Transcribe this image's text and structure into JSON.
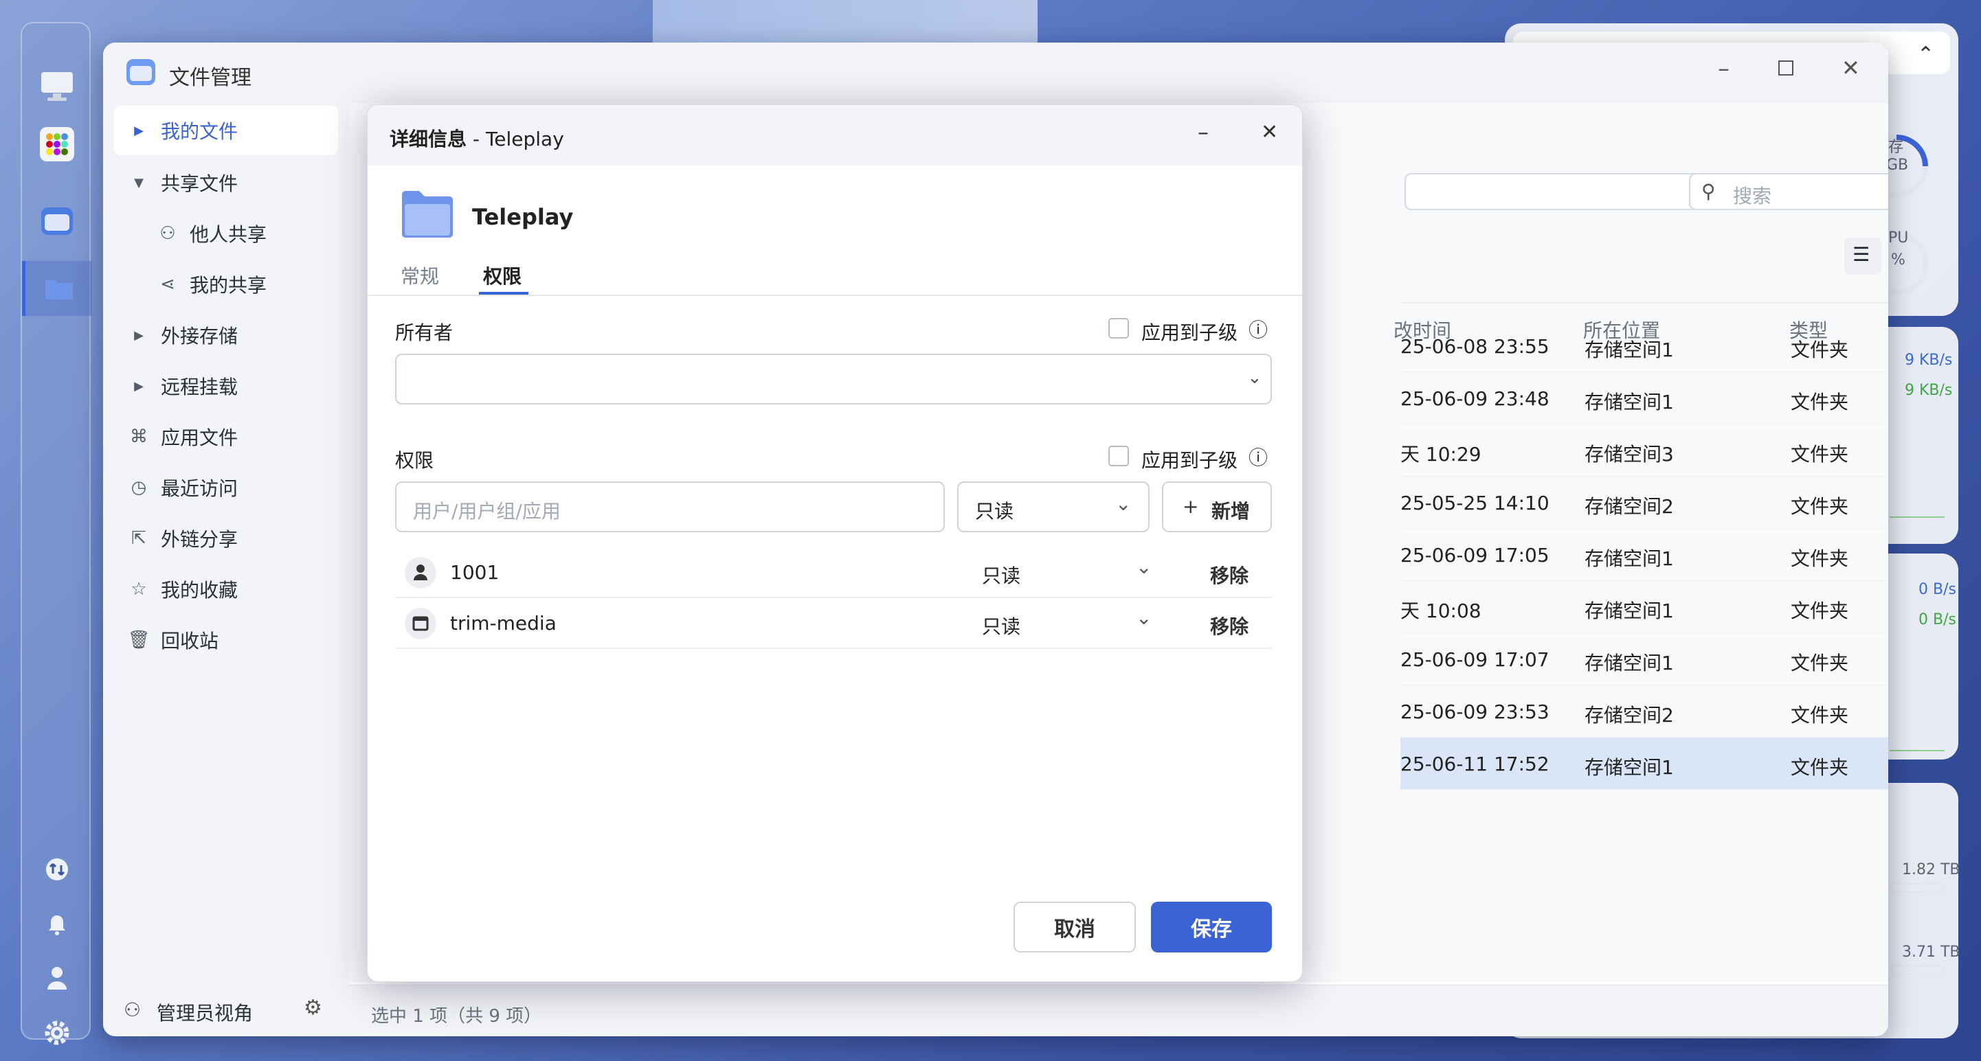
{
  "window": {
    "title": "文件管理"
  },
  "sidebar": {
    "items": [
      {
        "label": "我的文件"
      },
      {
        "label": "共享文件"
      },
      {
        "label": "他人共享"
      },
      {
        "label": "我的共享"
      },
      {
        "label": "外接存储"
      },
      {
        "label": "远程挂载"
      },
      {
        "label": "应用文件"
      },
      {
        "label": "最近访问"
      },
      {
        "label": "外链分享"
      },
      {
        "label": "我的收藏"
      },
      {
        "label": "回收站"
      }
    ],
    "footer_label": "管理员视角"
  },
  "search": {
    "placeholder": "搜索"
  },
  "table": {
    "headers": {
      "time": "改时间",
      "location": "所在位置",
      "type": "类型"
    },
    "rows": [
      {
        "time": "25-06-08 23:55",
        "location": "存储空间1",
        "type": "文件夹"
      },
      {
        "time": "25-06-09 23:48",
        "location": "存储空间1",
        "type": "文件夹"
      },
      {
        "time": "天 10:29",
        "location": "存储空间3",
        "type": "文件夹"
      },
      {
        "time": "25-05-25 14:10",
        "location": "存储空间2",
        "type": "文件夹"
      },
      {
        "time": "25-06-09 17:05",
        "location": "存储空间1",
        "type": "文件夹"
      },
      {
        "time": "天 10:08",
        "location": "存储空间1",
        "type": "文件夹"
      },
      {
        "time": "25-06-09 17:07",
        "location": "存储空间1",
        "type": "文件夹"
      },
      {
        "time": "25-06-09 23:53",
        "location": "存储空间2",
        "type": "文件夹"
      },
      {
        "time": "25-06-11 17:52",
        "location": "存储空间1",
        "type": "文件夹"
      }
    ]
  },
  "status": {
    "text": "选中 1 项（共 9 项）"
  },
  "widgets": {
    "mem_label": "存",
    "mem_value": "GB",
    "cpu_label": "PU",
    "cpu_value": "%",
    "net_up_1": "9 KB/s",
    "net_down_1": "9 KB/s",
    "net_up_2": "0 B/s",
    "net_down_2": "0 B/s",
    "disk_1": "1.82 TB",
    "disk_2": "3.71 TB"
  },
  "dialog": {
    "title": "详细信息",
    "title_sep": " - ",
    "title_name": "Teleplay",
    "folder_name": "Teleplay",
    "tabs": [
      "常规",
      "权限"
    ],
    "owner_label": "所有者",
    "apply_children": "应用到子级",
    "perm_label": "权限",
    "perm_placeholder": "用户/用户组/应用",
    "perm_select": "只读",
    "add_label": "新增",
    "entries": [
      {
        "name": "1001",
        "perm": "只读",
        "remove": "移除"
      },
      {
        "name": "trim-media",
        "perm": "只读",
        "remove": "移除"
      }
    ],
    "cancel": "取消",
    "save": "保存"
  },
  "colors": {
    "accent": "#3b63d6",
    "selected_row": "#dbe5f8"
  }
}
